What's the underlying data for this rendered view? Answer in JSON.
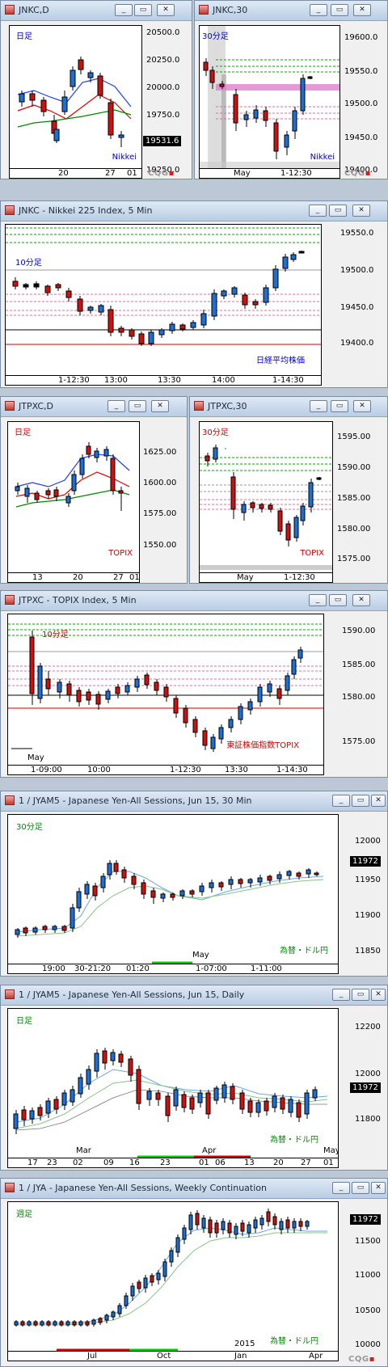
{
  "windows": [
    {
      "id": "w1",
      "title": "JNKC,D",
      "period": "日足",
      "period_color": "#0000cc",
      "ylabels": [
        "20500.0",
        "20250.0",
        "20000.0",
        "19750.0",
        "19250.0"
      ],
      "price_box": "19531.6",
      "xlabels": [
        "20",
        "27",
        "01"
      ],
      "name": "Nikkei",
      "name_color": "#0000cc",
      "cqg": "CQG"
    },
    {
      "id": "w2",
      "title": "JNKC,30",
      "period": "30分足",
      "period_color": "#0000cc",
      "ylabels": [
        "19600.0",
        "19550.0",
        "19500.0",
        "19450.0",
        "19400.0"
      ],
      "xlabels": [
        "May",
        "1-12:30"
      ],
      "name": "Nikkei",
      "name_color": "#0000cc",
      "cqg": "CQG"
    },
    {
      "id": "w3",
      "title": "JNKC - Nikkei 225 Index, 5 Min",
      "period": "10分足",
      "period_color": "#0000cc",
      "ylabels": [
        "19550.0",
        "19500.0",
        "19450.0",
        "19400.0"
      ],
      "xlabels": [
        "1-12:30",
        "13:00",
        "13:30",
        "14:00",
        "1-14:30"
      ],
      "name": "日経平均株価",
      "name_color": "#0000cc"
    },
    {
      "id": "w4",
      "title": "JTPXC,D",
      "period": "日足",
      "period_color": "#cc0000",
      "ylabels": [
        "1625.00",
        "1600.00",
        "1575.00",
        "1550.00"
      ],
      "xlabels": [
        "13",
        "20",
        "27",
        "01"
      ],
      "name": "TOPIX",
      "name_color": "#cc0000"
    },
    {
      "id": "w5",
      "title": "JTPXC,30",
      "period": "30分足",
      "period_color": "#cc0000",
      "ylabels": [
        "1595.00",
        "1590.00",
        "1585.00",
        "1580.00",
        "1575.00"
      ],
      "xlabels": [
        "May",
        "1-12:30"
      ],
      "name": "TOPIX",
      "name_color": "#cc0000"
    },
    {
      "id": "w6",
      "title": "JTPXC - TOPIX Index, 5 Min",
      "period": "10分足",
      "period_color": "#cc0000",
      "ylabels": [
        "1590.00",
        "1585.00",
        "1580.00",
        "1575.00"
      ],
      "xlabels": [
        "1-09:00",
        "10:00",
        "1-12:30",
        "13:30",
        "1-14:30"
      ],
      "may_label": "May",
      "name": "東証株価指数TOPIX",
      "name_color": "#cc0000"
    },
    {
      "id": "w7",
      "title": "1 / JYAM5 - Japanese Yen-All Sessions, Jun 15, 30 Min",
      "period": "30分足",
      "period_color": "#008800",
      "ylabels": [
        "12000",
        "11950",
        "11900",
        "11850"
      ],
      "price_box": "11972",
      "xlabels": [
        "19:00",
        "30-21:20",
        "01:20",
        "1-07:00",
        "1-11:00"
      ],
      "may_label": "May",
      "name": "為替・ドル円",
      "name_color": "#008800"
    },
    {
      "id": "w8",
      "title": "1 / JYAM5 - Japanese Yen-All Sessions, Jun 15, Daily",
      "period": "日足",
      "period_color": "#008800",
      "ylabels": [
        "12200",
        "12000",
        "11800"
      ],
      "price_box": "11972",
      "xlabels": [
        "17",
        "23",
        "02",
        "09",
        "16",
        "23",
        "01",
        "06",
        "13",
        "20",
        "27",
        "01"
      ],
      "month_labels": [
        "Mar",
        "Apr",
        "May"
      ],
      "name": "為替・ドル円",
      "name_color": "#008800"
    },
    {
      "id": "w9",
      "title": "1 / JYA - Japanese Yen-All Sessions, Weekly Continuation",
      "period": "週足",
      "period_color": "#008800",
      "ylabels": [
        "11500",
        "11000",
        "10500",
        "10000"
      ],
      "price_box": "11972",
      "xlabels": [
        "Jul",
        "Oct",
        "Jan",
        "Apr"
      ],
      "year_label": "2015",
      "name": "為替・ドル円",
      "name_color": "#008800",
      "cqg": "CQG"
    }
  ],
  "buttons": {
    "minimize": "_",
    "restore": "▭",
    "close": "✕"
  }
}
